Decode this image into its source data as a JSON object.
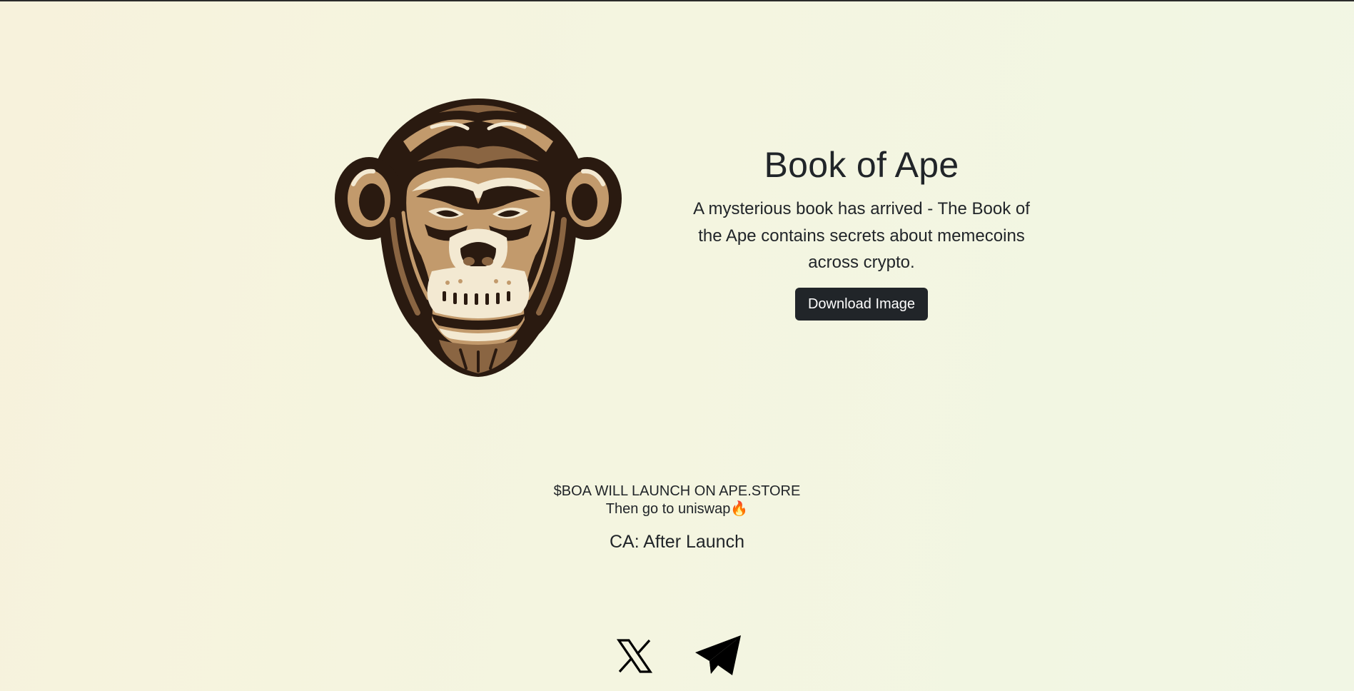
{
  "hero": {
    "title": "Book of Ape",
    "description": "A mysterious book has arrived - The Book of the Ape contains secrets about memecoins across crypto.",
    "download_button": "Download Image",
    "logo_icon": "ape-head-logo"
  },
  "launch": {
    "line1": "$BOA WILL LAUNCH ON APE.STORE",
    "line2": "Then go to uniswap🔥",
    "contract": "CA: After Launch"
  },
  "socials": [
    {
      "icon": "x-icon"
    },
    {
      "icon": "telegram-icon"
    }
  ],
  "colors": {
    "text": "#212529",
    "button_bg": "#212529",
    "button_text": "#ffffff",
    "ape_dark": "#2a1a10",
    "ape_mid": "#8a6542",
    "ape_light": "#c29a6c",
    "ape_cream": "#f3e9d2"
  }
}
